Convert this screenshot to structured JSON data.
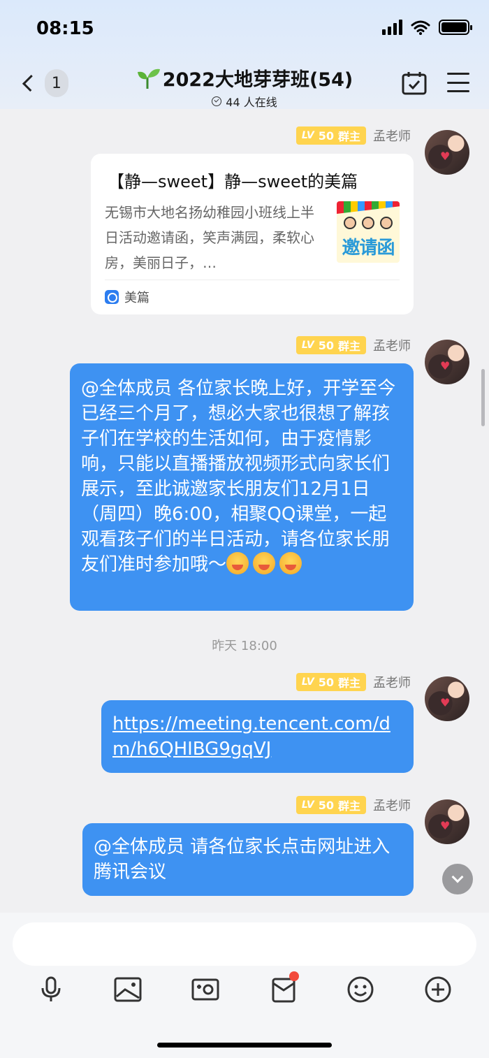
{
  "status_bar": {
    "time": "08:15"
  },
  "header": {
    "back_count": "1",
    "title": "2022大地芽芽班(54)",
    "subtitle": "44 人在线",
    "title_icon": "sprout-icon"
  },
  "sender": {
    "level": "LV",
    "level_num": "50",
    "role": "群主",
    "name": "孟老师"
  },
  "card": {
    "title": "【静—sweet】静—sweet的美篇",
    "description": "无锡市大地名扬幼稚园小班线上半日活动邀请函，笑声满园，柔软心房，美丽日子，…",
    "thumb_text": "邀请函",
    "source": "美篇"
  },
  "messages": {
    "m1": "@全体成员 各位家长晚上好，开学至今已经三个月了，想必大家也很想了解孩子们在学校的生活如何，由于疫情影响，只能以直播播放视频形式向家长们展示，至此诚邀家长朋友们12月1日（周四）晚6:00，相聚QQ课堂，一起观看孩子们的半日活动，请各位家长朋友们准时参加哦～",
    "m2_link": "https://meeting.tencent.com/dm/h6QHIBG9gqVJ",
    "m3": "@全体成员 请各位家长点击网址进入腾讯会议"
  },
  "timestamp": "昨天 18:00",
  "colors": {
    "bubble": "#3e92f2",
    "badge": "#ffd44f",
    "notify": "#f24a3c"
  }
}
